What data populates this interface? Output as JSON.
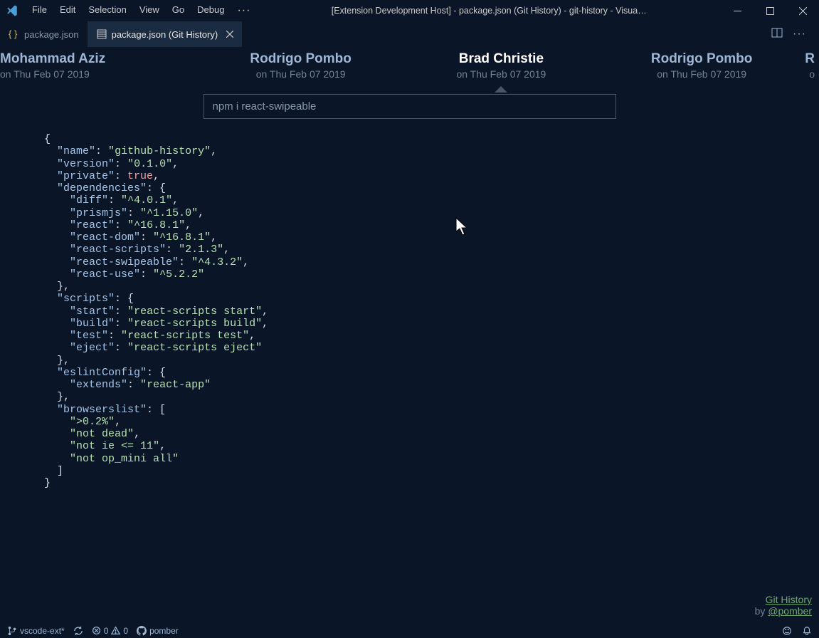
{
  "titlebar": {
    "menu": [
      "File",
      "Edit",
      "Selection",
      "View",
      "Go",
      "Debug"
    ],
    "title": "[Extension Development Host] - package.json (Git History) - git-history - Visua…"
  },
  "tabs": [
    {
      "label": "package.json",
      "active": false,
      "type": "json"
    },
    {
      "label": "package.json (Git History)",
      "active": true,
      "type": "preview"
    }
  ],
  "commits": [
    {
      "author": "Mohammad Aziz",
      "date": "on Thu Feb 07 2019",
      "active": false,
      "align": "left"
    },
    {
      "author": "Rodrigo Pombo",
      "date": "on Thu Feb 07 2019",
      "active": false,
      "align": "center"
    },
    {
      "author": "Brad Christie",
      "date": "on Thu Feb 07 2019",
      "active": true,
      "align": "center"
    },
    {
      "author": "Rodrigo Pombo",
      "date": "on Thu Feb 07 2019",
      "active": false,
      "align": "center"
    },
    {
      "author": "R",
      "date": "o",
      "active": false,
      "align": "right"
    }
  ],
  "commit_message": "npm i react-swipeable",
  "file": {
    "name": "github-history",
    "version": "0.1.0",
    "private": "true",
    "dependencies": {
      "diff": "^4.0.1",
      "prismjs": "^1.15.0",
      "react": "^16.8.1",
      "react-dom": "^16.8.1",
      "react-scripts": "2.1.3",
      "react-swipeable": "^4.3.2",
      "react-use": "^5.2.2"
    },
    "scripts": {
      "start": "react-scripts start",
      "build": "react-scripts build",
      "test": "react-scripts test",
      "eject": "react-scripts eject"
    },
    "eslintConfig": {
      "extends": "react-app"
    },
    "browserslist": [
      ">0.2%",
      "not dead",
      "not ie <= 11",
      "not op_mini all"
    ]
  },
  "attribution": {
    "title": "Git History",
    "by_prefix": "by ",
    "author": "@pomber"
  },
  "statusbar": {
    "branch": "vscode-ext*",
    "errors": "0",
    "warnings": "0",
    "user": "pomber"
  }
}
